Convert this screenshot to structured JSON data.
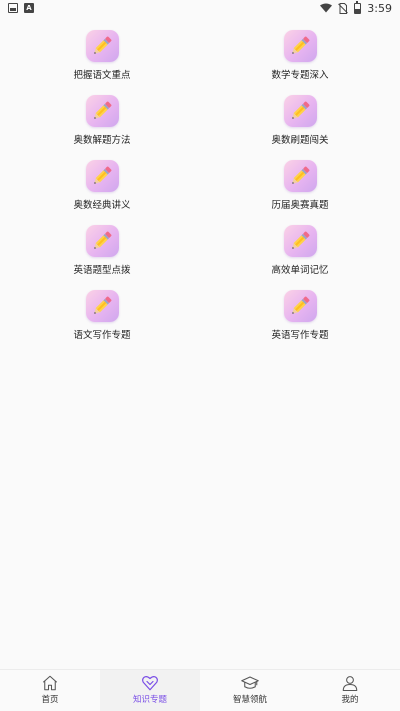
{
  "status_bar": {
    "time": "3:59",
    "left_icons": [
      "image-notification-icon",
      "a-notification-icon"
    ],
    "right_icons": [
      "wifi-icon",
      "no-sim-icon",
      "battery-icon"
    ]
  },
  "topics": [
    {
      "label": "把握语文重点",
      "icon": "pencil-icon"
    },
    {
      "label": "数学专题深入",
      "icon": "pencil-icon"
    },
    {
      "label": "奥数解题方法",
      "icon": "pencil-icon"
    },
    {
      "label": "奥数刷题闯关",
      "icon": "pencil-icon"
    },
    {
      "label": "奥数经典讲义",
      "icon": "pencil-icon"
    },
    {
      "label": "历届奥赛真题",
      "icon": "pencil-icon"
    },
    {
      "label": "英语题型点拨",
      "icon": "pencil-icon"
    },
    {
      "label": "高效单词记忆",
      "icon": "pencil-icon"
    },
    {
      "label": "语文写作专题",
      "icon": "pencil-icon"
    },
    {
      "label": "英语写作专题",
      "icon": "pencil-icon"
    }
  ],
  "bottom_nav": {
    "items": [
      {
        "label": "首页",
        "icon": "home-icon"
      },
      {
        "label": "知识专题",
        "icon": "heart-chevron-icon",
        "active": true
      },
      {
        "label": "智慧领航",
        "icon": "graduation-cap-icon"
      },
      {
        "label": "我的",
        "icon": "user-icon"
      }
    ]
  },
  "colors": {
    "accent": "#7a4ee6",
    "background": "#fafafa",
    "icon_gradient_start": "#fbd2e6",
    "icon_gradient_end": "#cfa7ee"
  }
}
